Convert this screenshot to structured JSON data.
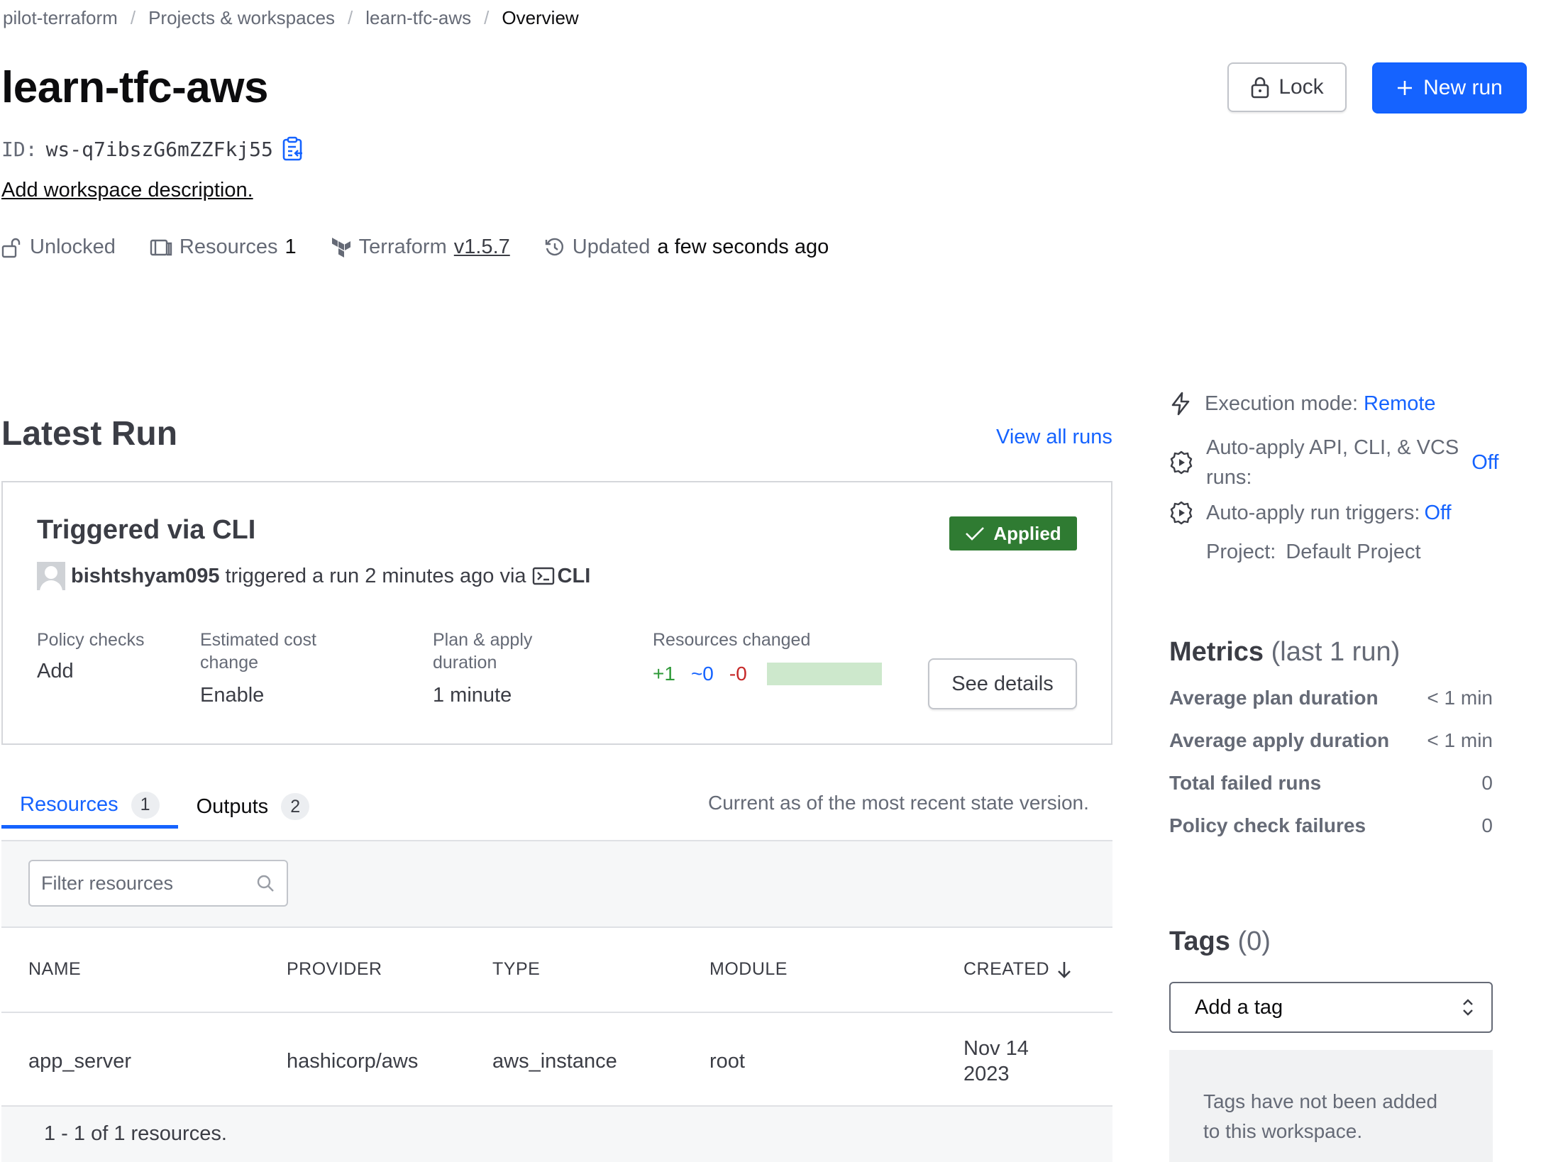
{
  "breadcrumb": [
    "pilot-terraform",
    "Projects & workspaces",
    "learn-tfc-aws",
    "Overview"
  ],
  "breadcrumb_separator": "/",
  "workspace": {
    "title": "learn-tfc-aws",
    "id_label": "ID:",
    "id_value": "ws-q7ibszG6mZZFkj55",
    "add_description": "Add workspace description."
  },
  "header_buttons": {
    "lock": "Lock",
    "new_run": "New run"
  },
  "meta": {
    "lock_state": "Unlocked",
    "resources_label": "Resources",
    "resources_count": "1",
    "terraform_label": "Terraform",
    "terraform_version": "v1.5.7",
    "updated_label": "Updated",
    "updated_value": "a few seconds ago"
  },
  "latest_run": {
    "heading": "Latest Run",
    "view_all": "View all runs",
    "title": "Triggered via CLI",
    "status": "Applied",
    "user": "bishtshyam095",
    "triggered_text": "triggered a run 2 minutes ago via",
    "via": "CLI",
    "policy_checks_label": "Policy checks",
    "policy_checks_value": "Add",
    "cost_label_1": "Estimated cost",
    "cost_label_2": "change",
    "cost_value": "Enable",
    "duration_label_1": "Plan & apply",
    "duration_label_2": "duration",
    "duration_value": "1 minute",
    "resources_changed_label": "Resources changed",
    "added": "+1",
    "changed": "~0",
    "destroyed": "-0",
    "see_details": "See details"
  },
  "tabs": [
    {
      "label": "Resources",
      "count": "1"
    },
    {
      "label": "Outputs",
      "count": "2"
    }
  ],
  "current_as_of": "Current as of the most recent state version.",
  "filter": {
    "placeholder": "Filter resources"
  },
  "table": {
    "columns": [
      "NAME",
      "PROVIDER",
      "TYPE",
      "MODULE",
      "CREATED"
    ],
    "rows": [
      {
        "name": "app_server",
        "provider": "hashicorp/aws",
        "type": "aws_instance",
        "module": "root",
        "created_1": "Nov 14",
        "created_2": "2023"
      }
    ],
    "footer": "1 - 1 of 1 resources."
  },
  "sidebar": {
    "execution_label": "Execution mode:",
    "execution_value": "Remote",
    "auto_apply_label_1": "Auto-apply API, CLI, & VCS",
    "auto_apply_label_2": "runs:",
    "auto_apply_value": "Off",
    "triggers_label": "Auto-apply run triggers:",
    "triggers_value": "Off",
    "project_label": "Project:",
    "project_value": "Default Project"
  },
  "metrics": {
    "heading": "Metrics",
    "subheading": "(last 1 run)",
    "items": [
      {
        "label": "Average plan duration",
        "value": "< 1 min"
      },
      {
        "label": "Average apply duration",
        "value": "< 1 min"
      },
      {
        "label": "Total failed runs",
        "value": "0"
      },
      {
        "label": "Policy check failures",
        "value": "0"
      }
    ]
  },
  "tags": {
    "heading": "Tags",
    "count": "(0)",
    "select_label": "Add a tag",
    "empty_line_1": "Tags have not been added",
    "empty_line_2": "to this workspace."
  },
  "colors": {
    "accent": "#1563ff",
    "applied": "#2f7b32",
    "added": "#2f9a39",
    "destroyed": "#c62828"
  }
}
